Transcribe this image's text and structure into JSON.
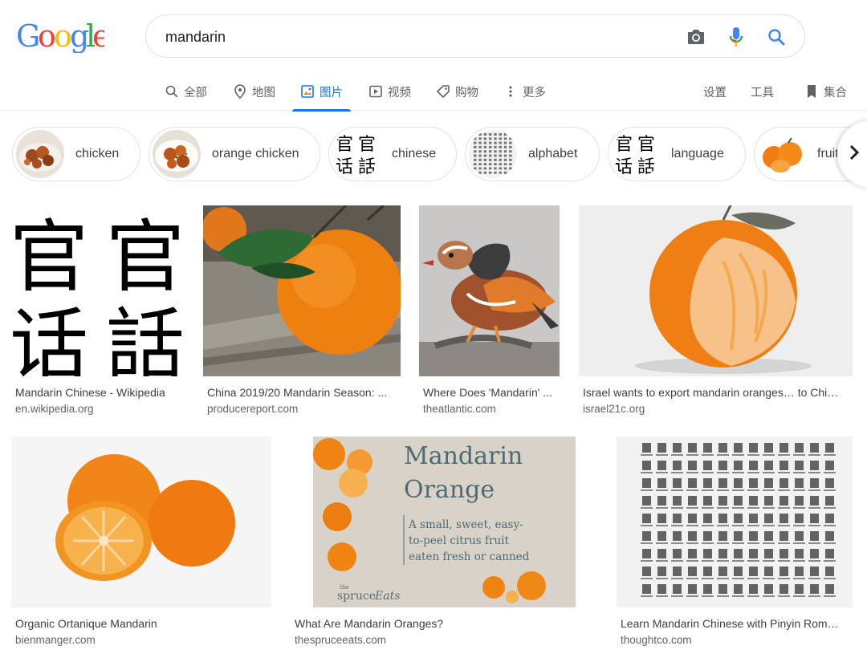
{
  "search": {
    "query": "mandarin"
  },
  "tabs": [
    {
      "label": "全部",
      "icon": "search-icon"
    },
    {
      "label": "地图",
      "icon": "map-pin-icon"
    },
    {
      "label": "图片",
      "icon": "image-icon",
      "active": true
    },
    {
      "label": "视频",
      "icon": "video-icon"
    },
    {
      "label": "购物",
      "icon": "tag-icon"
    },
    {
      "label": "更多",
      "icon": "more-vert-icon"
    }
  ],
  "tools": {
    "settings": "设置",
    "tools": "工具",
    "collections": "集合"
  },
  "chips": [
    {
      "label": "chicken",
      "thumb": "food-thumb"
    },
    {
      "label": "orange chicken",
      "thumb": "food-thumb"
    },
    {
      "label": "chinese",
      "thumb": "characters-thumb"
    },
    {
      "label": "alphabet",
      "thumb": "chart-thumb"
    },
    {
      "label": "language",
      "thumb": "characters-thumb"
    },
    {
      "label": "fruit",
      "thumb": "fruit-thumb"
    }
  ],
  "chip_chars": {
    "a": "官",
    "b": "官",
    "c": "话",
    "d": "話"
  },
  "results": [
    {
      "title": "Mandarin Chinese - Wikipedia",
      "source": "en.wikipedia.org",
      "chars": [
        "官",
        "官",
        "话",
        "話"
      ]
    },
    {
      "title": "China 2019/20 Mandarin Season: ...",
      "source": "producereport.com"
    },
    {
      "title": "Where Does 'Mandarin' ...",
      "source": "theatlantic.com"
    },
    {
      "title": "Israel wants to export mandarin oranges… to Chi…",
      "source": "israel21c.org"
    },
    {
      "title": "Organic Ortanique Mandarin",
      "source": "bienmanger.com"
    },
    {
      "title": "What Are Mandarin Oranges?",
      "source": "thespruceeats.com",
      "overlay": {
        "line1": "Mandarin",
        "line2": "Orange",
        "sub1": "A small, sweet, easy-",
        "sub2": "to-peel citrus fruit",
        "sub3": "eaten fresh or canned",
        "brand_small": "the",
        "brand": "spruce",
        "brand_script": "Eats"
      }
    },
    {
      "title": "Learn Mandarin Chinese with Pinyin Rom…",
      "source": "thoughtco.com"
    }
  ],
  "colors": {
    "accent": "#1a73e8",
    "google_blue": "#4285f4",
    "google_red": "#ea4335",
    "google_yellow": "#fbbc05",
    "google_green": "#34a853"
  }
}
